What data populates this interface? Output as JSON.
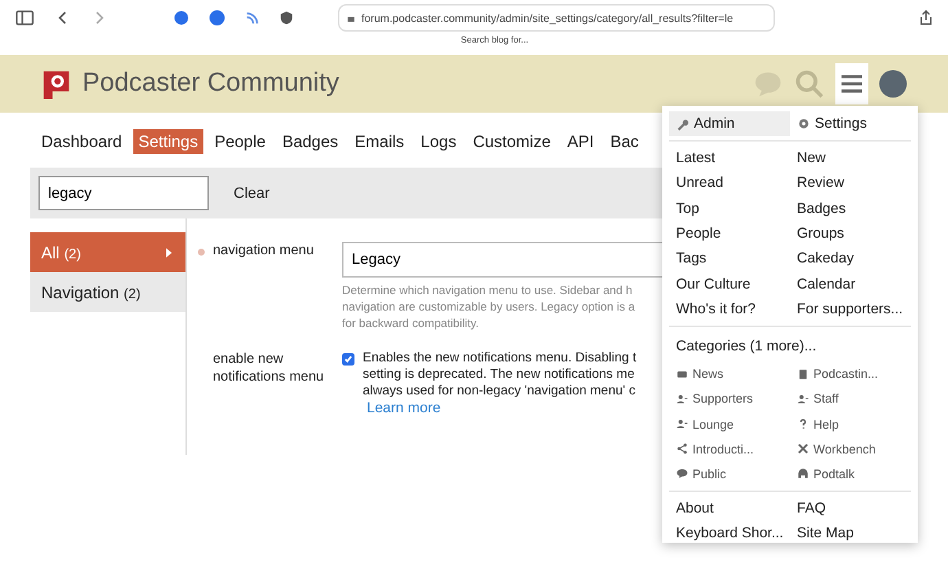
{
  "browser": {
    "url": "forum.podcaster.community/admin/site_settings/category/all_results?filter=le",
    "tooltip": "Search blog for..."
  },
  "header": {
    "title": "Podcaster Community",
    "menu_open": true
  },
  "admin_tabs": [
    {
      "label": "Dashboard",
      "selected": false
    },
    {
      "label": "Settings",
      "selected": true
    },
    {
      "label": "People",
      "selected": false
    },
    {
      "label": "Badges",
      "selected": false
    },
    {
      "label": "Emails",
      "selected": false
    },
    {
      "label": "Logs",
      "selected": false
    },
    {
      "label": "Customize",
      "selected": false
    },
    {
      "label": "API",
      "selected": false
    },
    {
      "label": "Bac",
      "selected": false
    }
  ],
  "filter": {
    "value": "legacy",
    "clear": "Clear"
  },
  "categories": [
    {
      "label": "All",
      "count": "(2)",
      "selected": true
    },
    {
      "label": "Navigation",
      "count": "(2)",
      "selected": false
    }
  ],
  "settings": [
    {
      "kind": "select",
      "label": "navigation menu",
      "value": "Legacy",
      "description_lines": [
        "Determine which navigation menu to use. Sidebar and h",
        "navigation are customizable by users. Legacy option is a",
        "for backward compatibility."
      ]
    },
    {
      "kind": "checkbox",
      "label": "enable new notifications menu",
      "checked": true,
      "description_lines": [
        "Enables the new notifications menu. Disabling t",
        "setting is deprecated. The new notifications me",
        "always used for non-legacy 'navigation menu' c"
      ],
      "link": "Learn more"
    }
  ],
  "menu": {
    "top": [
      {
        "label": "Admin",
        "selected": true
      },
      {
        "label": "Settings",
        "selected": false
      }
    ],
    "links": [
      "Latest",
      "New",
      "Unread",
      "Review",
      "Top",
      "Badges",
      "People",
      "Groups",
      "Tags",
      "Cakeday",
      "Our Culture",
      "Calendar",
      "Who's it for?",
      "For supporters..."
    ],
    "categories_title": "Categories (1 more)...",
    "categories": [
      "News",
      "Podcastin...",
      "Supporters",
      "Staff",
      "Lounge",
      "Help",
      "Introducti...",
      "Workbench",
      "Public",
      "Podtalk"
    ],
    "footer": [
      "About",
      "FAQ",
      "Keyboard Shor...",
      "Site Map"
    ]
  }
}
